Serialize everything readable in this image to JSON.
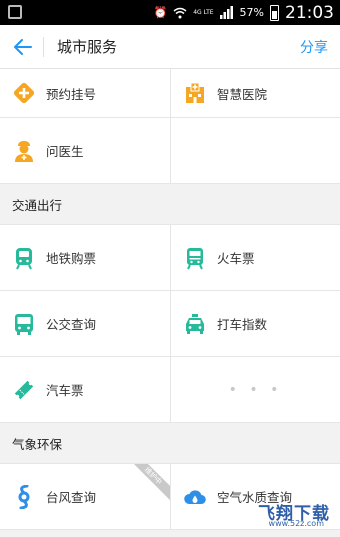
{
  "status_bar": {
    "network": "4G LTE",
    "battery": "57%",
    "time": "21:03"
  },
  "header": {
    "title": "城市服务",
    "share_label": "分享"
  },
  "colors": {
    "accent": "#2196f3",
    "orange": "#f5a623",
    "teal": "#26b99a",
    "blue": "#2e8fe6"
  },
  "medical": {
    "items": [
      {
        "label": "预约挂号",
        "icon": "plus-diamond-icon"
      },
      {
        "label": "智慧医院",
        "icon": "hospital-icon"
      },
      {
        "label": "问医生",
        "icon": "doctor-icon"
      }
    ]
  },
  "transport": {
    "title": "交通出行",
    "items": [
      {
        "label": "地铁购票",
        "icon": "subway-icon"
      },
      {
        "label": "火车票",
        "icon": "train-icon"
      },
      {
        "label": "公交查询",
        "icon": "bus-icon"
      },
      {
        "label": "打车指数",
        "icon": "taxi-icon"
      },
      {
        "label": "汽车票",
        "icon": "ticket-icon"
      }
    ],
    "more_label": "• • •"
  },
  "weather": {
    "title": "气象环保",
    "items": [
      {
        "label": "台风查询",
        "icon": "typhoon-icon",
        "badge": "维护中"
      },
      {
        "label": "空气水质查询",
        "icon": "cloud-drop-icon"
      }
    ]
  },
  "watermark": {
    "main": "飞翔下载",
    "sub": "www.52z.com"
  }
}
